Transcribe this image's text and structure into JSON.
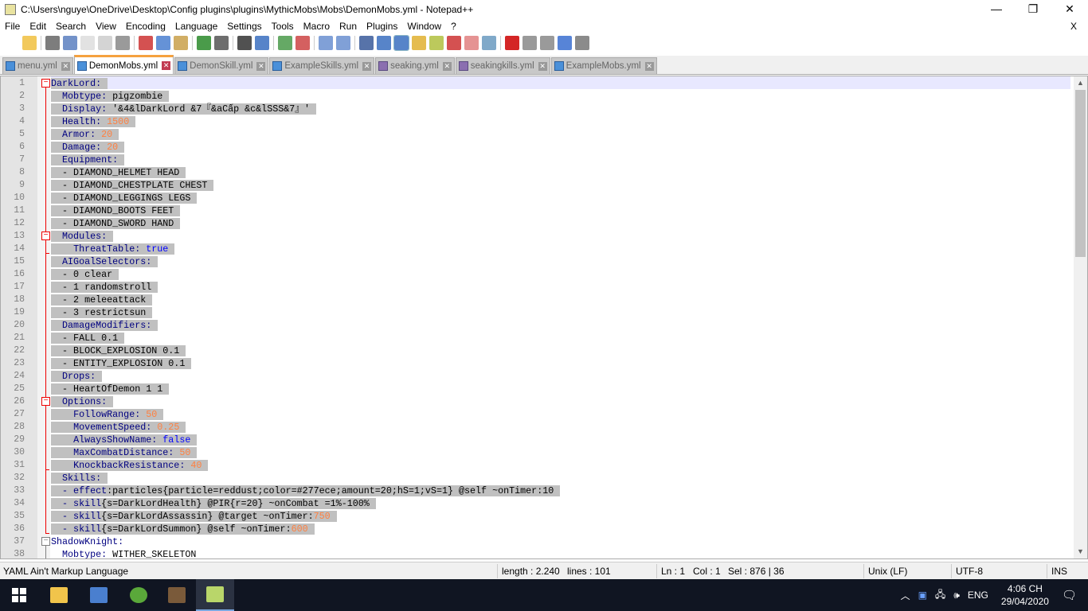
{
  "window": {
    "title": "C:\\Users\\nguye\\OneDrive\\Desktop\\Config plugins\\plugins\\MythicMobs\\Mobs\\DemonMobs.yml - Notepad++",
    "minimize": "—",
    "maximize": "❐",
    "close": "✕"
  },
  "menu": [
    "File",
    "Edit",
    "Search",
    "View",
    "Encoding",
    "Language",
    "Settings",
    "Tools",
    "Macro",
    "Run",
    "Plugins",
    "Window",
    "?"
  ],
  "menu_close": "X",
  "toolbar": [
    "new",
    "open",
    "save",
    "save-all",
    "close",
    "close-all",
    "print",
    "cut",
    "copy",
    "paste",
    "undo",
    "redo",
    "find",
    "replace",
    "zoom-in",
    "zoom-out",
    "sync-v",
    "sync-h",
    "wrap",
    "all-chars",
    "indent-guide",
    "udl",
    "doc-map",
    "function-list",
    "folder-workspace",
    "monitor",
    "record",
    "stop",
    "play",
    "play-multi",
    "save-macro"
  ],
  "tabs": [
    {
      "label": "menu.yml",
      "active": false,
      "p": false
    },
    {
      "label": "DemonMobs.yml",
      "active": true,
      "p": false
    },
    {
      "label": "DemonSkill.yml",
      "active": false,
      "p": false
    },
    {
      "label": "ExampleSkills.yml",
      "active": false,
      "p": false
    },
    {
      "label": "seaking.yml",
      "active": false,
      "p": true
    },
    {
      "label": "seakingkills.yml",
      "active": false,
      "p": true
    },
    {
      "label": "ExampleMobs.yml",
      "active": false,
      "p": false
    }
  ],
  "lines": [
    [
      [
        "k",
        "DarkLord:"
      ]
    ],
    [
      [
        "v",
        "  "
      ],
      [
        "k",
        "Mobtype:"
      ],
      [
        "v",
        " pigzombie"
      ]
    ],
    [
      [
        "v",
        "  "
      ],
      [
        "k",
        "Display:"
      ],
      [
        "v",
        " '&4&lDarkLord &7『&aCấp &c&lSSS&7』'"
      ]
    ],
    [
      [
        "v",
        "  "
      ],
      [
        "k",
        "Health:"
      ],
      [
        "v",
        " "
      ],
      [
        "n",
        "1500"
      ]
    ],
    [
      [
        "v",
        "  "
      ],
      [
        "k",
        "Armor:"
      ],
      [
        "v",
        " "
      ],
      [
        "n",
        "20"
      ]
    ],
    [
      [
        "v",
        "  "
      ],
      [
        "k",
        "Damage:"
      ],
      [
        "v",
        " "
      ],
      [
        "n",
        "20"
      ]
    ],
    [
      [
        "v",
        "  "
      ],
      [
        "k",
        "Equipment:"
      ]
    ],
    [
      [
        "v",
        "  - DIAMOND_HELMET HEAD"
      ]
    ],
    [
      [
        "v",
        "  - DIAMOND_CHESTPLATE CHEST"
      ]
    ],
    [
      [
        "v",
        "  - DIAMOND_LEGGINGS LEGS"
      ]
    ],
    [
      [
        "v",
        "  - DIAMOND_BOOTS FEET"
      ]
    ],
    [
      [
        "v",
        "  - DIAMOND_SWORD HAND"
      ]
    ],
    [
      [
        "v",
        "  "
      ],
      [
        "k",
        "Modules:"
      ]
    ],
    [
      [
        "v",
        "    "
      ],
      [
        "k",
        "ThreatTable:"
      ],
      [
        "v",
        " "
      ],
      [
        "b",
        "true"
      ]
    ],
    [
      [
        "v",
        "  "
      ],
      [
        "k",
        "AIGoalSelectors:"
      ]
    ],
    [
      [
        "v",
        "  - 0 clear"
      ]
    ],
    [
      [
        "v",
        "  - 1 randomstroll"
      ]
    ],
    [
      [
        "v",
        "  - 2 meleeattack"
      ]
    ],
    [
      [
        "v",
        "  - 3 restrictsun"
      ]
    ],
    [
      [
        "v",
        "  "
      ],
      [
        "k",
        "DamageModifiers:"
      ]
    ],
    [
      [
        "v",
        "  - FALL 0.1"
      ]
    ],
    [
      [
        "v",
        "  - BLOCK_EXPLOSION 0.1"
      ]
    ],
    [
      [
        "v",
        "  - ENTITY_EXPLOSION 0.1"
      ]
    ],
    [
      [
        "v",
        "  "
      ],
      [
        "k",
        "Drops:"
      ]
    ],
    [
      [
        "v",
        "  - HeartOfDemon 1 1"
      ]
    ],
    [
      [
        "v",
        "  "
      ],
      [
        "k",
        "Options:"
      ]
    ],
    [
      [
        "v",
        "    "
      ],
      [
        "k",
        "FollowRange:"
      ],
      [
        "v",
        " "
      ],
      [
        "n",
        "50"
      ]
    ],
    [
      [
        "v",
        "    "
      ],
      [
        "k",
        "MovementSpeed:"
      ],
      [
        "v",
        " "
      ],
      [
        "n",
        "0.25"
      ]
    ],
    [
      [
        "v",
        "    "
      ],
      [
        "k",
        "AlwaysShowName:"
      ],
      [
        "v",
        " "
      ],
      [
        "b",
        "false"
      ]
    ],
    [
      [
        "v",
        "    "
      ],
      [
        "k",
        "MaxCombatDistance:"
      ],
      [
        "v",
        " "
      ],
      [
        "n",
        "50"
      ]
    ],
    [
      [
        "v",
        "    "
      ],
      [
        "k",
        "KnockbackResistance:"
      ],
      [
        "v",
        " "
      ],
      [
        "n",
        "40"
      ]
    ],
    [
      [
        "v",
        "  "
      ],
      [
        "k",
        "Skills:"
      ]
    ],
    [
      [
        "v",
        "  "
      ],
      [
        "p",
        "- effect"
      ],
      [
        "v",
        ":particles{particle=reddust;color=#277ece;amount=20;hS=1;vS=1} @self ~onTimer:10"
      ]
    ],
    [
      [
        "p",
        "  - skill"
      ],
      [
        "v",
        "{s=DarkLordHealth} @PIR{r=20} ~onCombat =1%-100%"
      ]
    ],
    [
      [
        "p",
        "  - skill"
      ],
      [
        "v",
        "{s=DarkLordAssassin} @target ~onTimer:"
      ],
      [
        "n",
        "750"
      ]
    ],
    [
      [
        "p",
        "  - skill"
      ],
      [
        "v",
        "{s=DarkLordSummon} @self ~onTimer:"
      ],
      [
        "n",
        "600"
      ]
    ],
    [
      [
        "k",
        "ShadowKnight:"
      ]
    ],
    [
      [
        "v",
        "  "
      ],
      [
        "k",
        "Mobtype:"
      ],
      [
        "v",
        " WITHER_SKELETON"
      ]
    ]
  ],
  "status": {
    "language": "YAML Ain't Markup Language",
    "length": "length : 2.240",
    "lines": "lines : 101",
    "ln": "Ln : 1",
    "col": "Col : 1",
    "sel": "Sel : 876 | 36",
    "eol": "Unix (LF)",
    "encoding": "UTF-8",
    "mode": "INS"
  },
  "tray": {
    "lang": "ENG",
    "time": "4:06 CH",
    "date": "29/04/2020"
  },
  "colors": {
    "accent": "#f5a13f",
    "selection": "#c0c0c0",
    "current_line": "#e8e8ff",
    "key": "#000080",
    "number": "#ff8040",
    "bool": "#0000ff"
  }
}
